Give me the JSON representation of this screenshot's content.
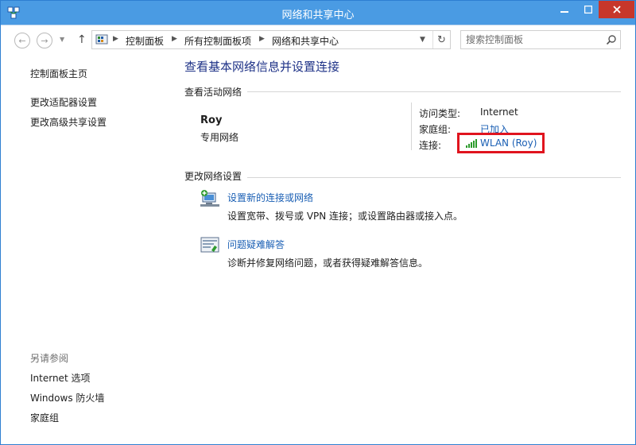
{
  "window": {
    "title": "网络和共享中心"
  },
  "navigation": {
    "breadcrumbs": [
      "控制面板",
      "所有控制面板项",
      "网络和共享中心"
    ],
    "search_placeholder": "搜索控制面板"
  },
  "sidebar": {
    "home_link": "控制面板主页",
    "links": [
      "更改适配器设置",
      "更改高级共享设置"
    ],
    "see_also_label": "另请参阅",
    "see_also_links": [
      "Internet 选项",
      "Windows 防火墙",
      "家庭组"
    ]
  },
  "main": {
    "page_title": "查看基本网络信息并设置连接",
    "active_networks_heading": "查看活动网络",
    "network": {
      "name": "Roy",
      "type": "专用网络",
      "access_type_label": "访问类型:",
      "access_type_value": "Internet",
      "homegroup_label": "家庭组:",
      "homegroup_value": "已加入",
      "connection_label": "连接:",
      "connection_value": "WLAN (Roy)"
    },
    "change_settings_heading": "更改网络设置",
    "tasks": [
      {
        "title": "设置新的连接或网络",
        "description": "设置宽带、拨号或 VPN 连接；或设置路由器或接入点。"
      },
      {
        "title": "问题疑难解答",
        "description": "诊断并修复网络问题，或者获得疑难解答信息。"
      }
    ]
  },
  "colors": {
    "titlebar": "#4a9be3",
    "close_button": "#c7372b",
    "link": "#1a5fb4",
    "page_title": "#1e3287",
    "highlight_box": "#e0141e"
  }
}
